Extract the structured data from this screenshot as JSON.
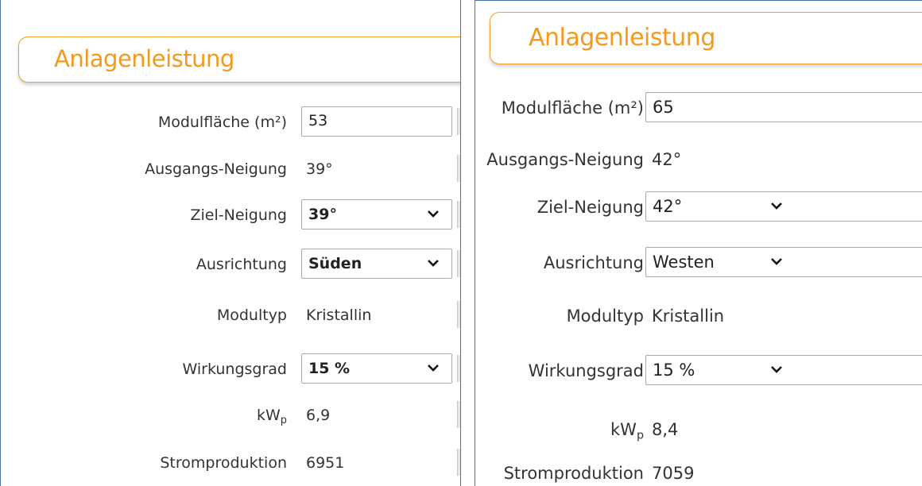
{
  "left_panel": {
    "section_title": "Anlagenleistung",
    "modulflaeche": {
      "label": "Modulfläche (m²)",
      "value": "53"
    },
    "ausgangs_neigung": {
      "label": "Ausgangs-Neigung",
      "value": "39°"
    },
    "ziel_neigung": {
      "label": "Ziel-Neigung",
      "selected": "39°"
    },
    "ausrichtung": {
      "label": "Ausrichtung",
      "selected": "Süden"
    },
    "modultyp": {
      "label": "Modultyp",
      "value": "Kristallin"
    },
    "wirkungsgrad": {
      "label": "Wirkungsgrad",
      "selected": "15 %"
    },
    "kwp": {
      "label_main": "kW",
      "label_sub": "p",
      "value": "6,9"
    },
    "stromproduktion": {
      "label": "Stromproduktion",
      "value": "6951"
    }
  },
  "right_panel": {
    "section_title": "Anlagenleistung",
    "modulflaeche": {
      "label": "Modulfläche (m²)",
      "value": "65"
    },
    "ausgangs_neigung": {
      "label": "Ausgangs-Neigung",
      "value": "42°"
    },
    "ziel_neigung": {
      "label": "Ziel-Neigung",
      "selected": "42°"
    },
    "ausrichtung": {
      "label": "Ausrichtung",
      "selected": "Westen"
    },
    "modultyp": {
      "label": "Modultyp",
      "value": "Kristallin"
    },
    "wirkungsgrad": {
      "label": "Wirkungsgrad",
      "selected": "15 %"
    },
    "kwp": {
      "label_main": "kW",
      "label_sub": "p",
      "value": "8,4"
    },
    "stromproduktion": {
      "label": "Stromproduktion",
      "value": "7059"
    }
  },
  "colors": {
    "accent": "#f39a1e",
    "header_border": "#f0a030",
    "panel_border": "#4a6fb5",
    "text": "#333333"
  },
  "icons": {
    "select_arrow": "chevron-down-icon"
  }
}
